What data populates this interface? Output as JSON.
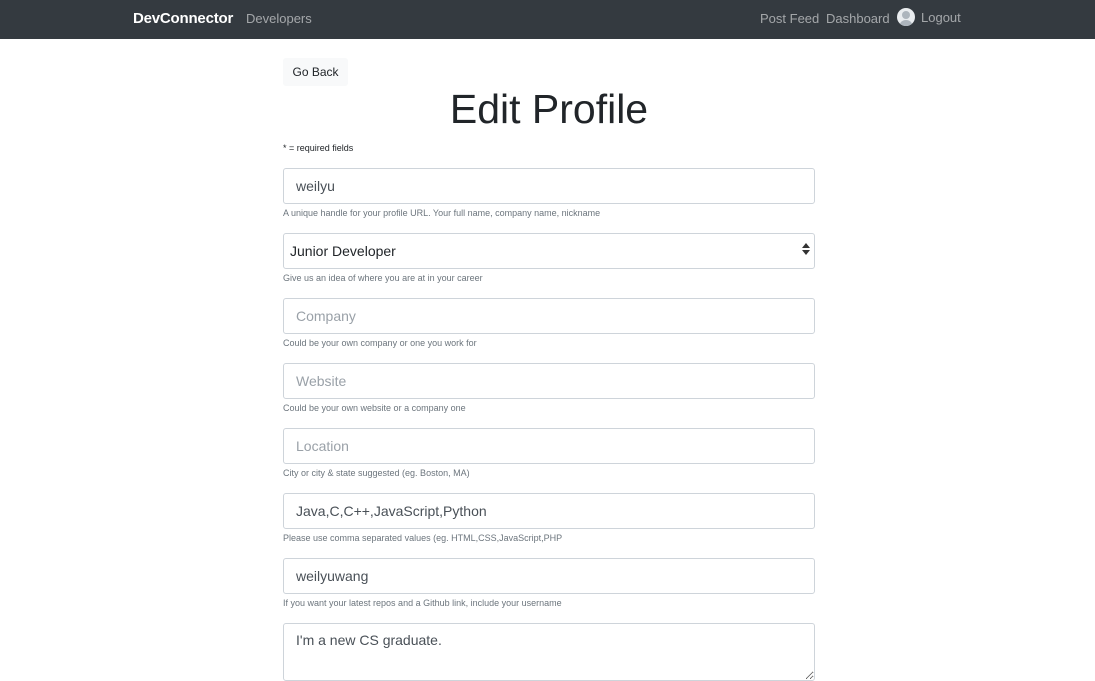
{
  "navbar": {
    "brand": "DevConnector",
    "developers": "Developers",
    "post_feed": "Post Feed",
    "dashboard": "Dashboard",
    "logout": "Logout"
  },
  "go_back_label": "Go Back",
  "title": "Edit Profile",
  "required_note": "* = required fields",
  "form": {
    "handle": {
      "value": "weilyu",
      "help": "A unique handle for your profile URL. Your full name, company name, nickname"
    },
    "status": {
      "value": "Junior Developer",
      "help": "Give us an idea of where you are at in your career"
    },
    "company": {
      "value": "",
      "placeholder": "Company",
      "help": "Could be your own company or one you work for"
    },
    "website": {
      "value": "",
      "placeholder": "Website",
      "help": "Could be your own website or a company one"
    },
    "location": {
      "value": "",
      "placeholder": "Location",
      "help": "City or city & state suggested (eg. Boston, MA)"
    },
    "skills": {
      "value": "Java,C,C++,JavaScript,Python",
      "help": "Please use comma separated values (eg. HTML,CSS,JavaScript,PHP"
    },
    "github": {
      "value": "weilyuwang",
      "help": "If you want your latest repos and a Github link, include your username"
    },
    "bio": {
      "value": "I'm a new CS graduate."
    }
  }
}
